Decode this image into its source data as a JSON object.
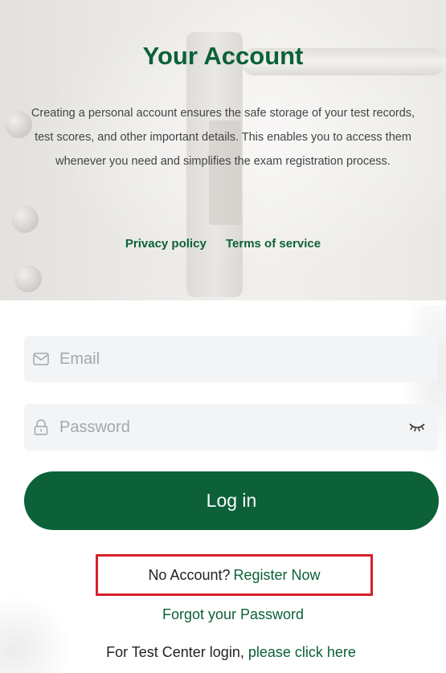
{
  "hero": {
    "title": "Your Account",
    "description": "Creating a personal account ensures the safe storage of your test records, test scores, and other important details. This enables you to access them whenever you need and simplifies the exam registration process.",
    "privacy_label": "Privacy policy",
    "terms_label": "Terms of service"
  },
  "form": {
    "email_placeholder": "Email",
    "email_value": "",
    "password_placeholder": "Password",
    "password_value": "",
    "email_icon": "envelope-icon",
    "password_icon": "lock-icon",
    "toggle_icon": "eye-closed-icon",
    "login_label": "Log in"
  },
  "register": {
    "prompt": "No Account?",
    "link": "Register Now"
  },
  "forgot_label": "Forgot your Password",
  "test_center": {
    "prefix": "For Test Center login,",
    "link": "please click here"
  },
  "colors": {
    "brand_green": "#0c6138",
    "highlight_red": "#d6202a",
    "field_bg": "#f3f4f6"
  }
}
